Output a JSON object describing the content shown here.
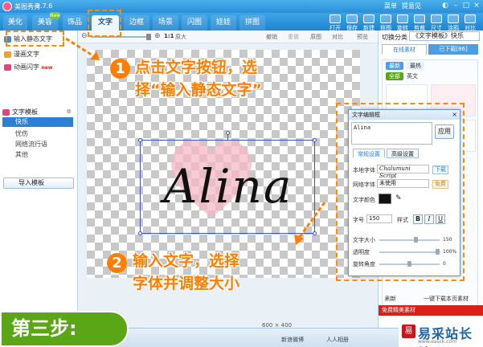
{
  "titlebar": {
    "app_name": "美图秀秀",
    "version": "2.7.6",
    "menu_items": [
      "菜单",
      "提意见"
    ]
  },
  "nav": {
    "tabs": [
      "美化",
      "美容",
      "饰品",
      "文字",
      "边框",
      "场景",
      "闪图",
      "娃娃",
      "拼图"
    ],
    "active_tab": "文字",
    "new_badge": "New",
    "tools": [
      "打开",
      "保存",
      "新建",
      "抠图",
      "旋转",
      "剪裁",
      "尺寸",
      "涂鸦",
      "对比"
    ]
  },
  "sidebar": {
    "items": [
      "输入静态文字",
      "漫画文字",
      "动画闪字"
    ],
    "new_tag": "new",
    "tree_header": "文字模板",
    "tree_selected": "快乐",
    "tree_items": [
      "忧伤",
      "网络流行语",
      "其他"
    ],
    "import_button": "导入模板"
  },
  "canvas_toolbar": {
    "zoom_ratio": "1:1",
    "original_size": "原大",
    "actions": [
      "撤销",
      "重做",
      "原图",
      "对比",
      "预览"
    ]
  },
  "canvas": {
    "text": "Alina",
    "size_label": "600 × 400"
  },
  "right_panel": {
    "category_label": "切换分类",
    "category_value": "《文字模板》快乐",
    "tabs": [
      "在线素材",
      "已下载[86]"
    ],
    "chips": [
      "最新",
      "最热"
    ],
    "filters": [
      "全部",
      "英文"
    ],
    "refresh": "刷新",
    "download_page": "一键下载本页素材",
    "free_apply": "免费精美素材"
  },
  "dialog": {
    "title": "文字编辑框",
    "input_text": "Alina",
    "apply_button": "应用",
    "tabs": [
      "常规设置",
      "高级设置"
    ],
    "local_font_label": "本地字体",
    "local_font_value": "Chalumuni Script",
    "download_link": "下载",
    "web_font_label": "网络字体",
    "web_font_value": "未使用",
    "free_link": "免费",
    "color_label": "文字颜色",
    "font_size_label": "字号",
    "font_size_value": "150",
    "style_label": "样式",
    "style_buttons": [
      "B",
      "I",
      "U"
    ],
    "sliders": [
      {
        "label": "文字大小",
        "value": "150",
        "fraction": 0.62
      },
      {
        "label": "透明度",
        "value": "100%",
        "fraction": 1.0
      },
      {
        "label": "旋转角度",
        "value": "0",
        "fraction": 0.5
      }
    ]
  },
  "annotations": {
    "step1_number": "1",
    "step1_line1": "点击文字按钮，选",
    "step1_line2": "择“输入静态文字”",
    "step2_number": "2",
    "step2_line1": "输入文字，选择",
    "step2_line2": "字体并调整大小",
    "step_badge": "第三步:",
    "color": "#ff7e00"
  },
  "statusbar": {
    "items": [
      "新浪微博",
      "人人相册"
    ]
  },
  "watermark": {
    "logo_glyph": "易",
    "name": "易采站长站",
    "url": "www.easck.com"
  }
}
